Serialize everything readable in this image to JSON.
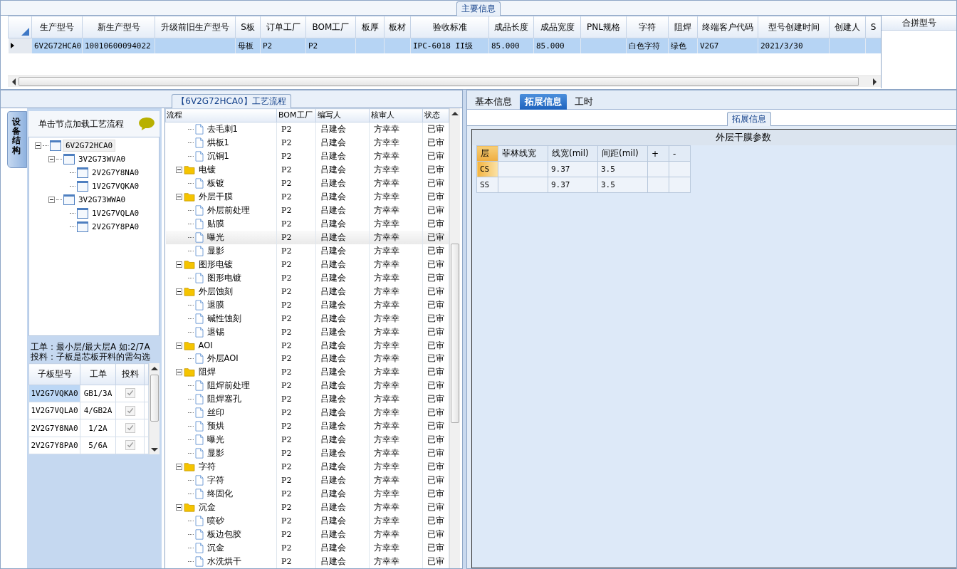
{
  "main_info": {
    "legend": "主要信息",
    "columns": [
      "生产型号",
      "新生产型号",
      "升级前旧生产型号",
      "S板",
      "订单工厂",
      "BOM工厂",
      "板厚",
      "板材",
      "验收标准",
      "成品长度",
      "成品宽度",
      "PNL规格",
      "字符",
      "阻焊",
      "终端客户代码",
      "型号创建时间",
      "创建人",
      "S"
    ],
    "rows": [
      {
        "selected": true,
        "cells": [
          "6V2G72HCA0",
          "10010600094022",
          "",
          "母板",
          "P2",
          "P2",
          "",
          "",
          "IPC-6018 II级",
          "85.000",
          "85.000",
          "",
          "白色字符",
          "绿色",
          "V2G7",
          "2021/3/30",
          "",
          ""
        ]
      }
    ],
    "merge_panel": {
      "header": "合拼型号"
    }
  },
  "process": {
    "legend": "【6V2G72HCA0】工艺流程",
    "side_tab": "设备结构",
    "hint_header": "单击节点加载工艺流程",
    "tree": [
      {
        "label": "6V2G72HCA0",
        "selected": true,
        "expanded": true,
        "children": [
          {
            "label": "3V2G73WVA0",
            "selected": false,
            "expanded": true,
            "children": [
              {
                "label": "2V2G7Y8NA0",
                "selected": false
              },
              {
                "label": "1V2G7VQKA0",
                "selected": false
              }
            ]
          },
          {
            "label": "3V2G73WWA0",
            "selected": false,
            "expanded": true,
            "children": [
              {
                "label": "1V2G7VQLA0",
                "selected": false
              },
              {
                "label": "2V2G7Y8PA0",
                "selected": false
              }
            ]
          }
        ]
      }
    ],
    "notes": [
      "工单：最小层/最大层A 如:2/7A",
      "投料：子板是芯板开料的需勾选"
    ],
    "sub_columns": [
      "子板型号",
      "工单",
      "投料"
    ],
    "sub_rows": [
      {
        "model": "1V2G7VQKA0",
        "order": "GB1/3A",
        "checked": true,
        "selected": true
      },
      {
        "model": "1V2G7VQLA0",
        "order": "4/GB2A",
        "checked": true,
        "selected": false
      },
      {
        "model": "2V2G7Y8NA0",
        "order": "1/2A",
        "checked": true,
        "selected": false
      },
      {
        "model": "2V2G7Y8PA0",
        "order": "5/6A",
        "checked": true,
        "selected": false
      }
    ],
    "flow_columns": [
      "流程",
      "BOM工厂",
      "编写人",
      "核审人",
      "状态"
    ],
    "flow": [
      {
        "kind": "cut",
        "children": [
          {
            "kind": "step",
            "name": "去毛刺1",
            "bom": "P2",
            "author": "吕建会",
            "reviewer": "方幸幸",
            "status": "已审",
            "selected": false
          },
          {
            "kind": "step",
            "name": "烘板1",
            "bom": "P2",
            "author": "吕建会",
            "reviewer": "方幸幸",
            "status": "已审",
            "selected": false
          },
          {
            "kind": "step",
            "name": "沉铜1",
            "bom": "P2",
            "author": "吕建会",
            "reviewer": "方幸幸",
            "status": "已审",
            "selected": false
          }
        ]
      },
      {
        "kind": "group",
        "name": "电镀",
        "bom": "P2",
        "author": "吕建会",
        "reviewer": "方幸幸",
        "status": "已审",
        "expanded": true,
        "children": [
          {
            "kind": "step",
            "name": "板镀",
            "bom": "P2",
            "author": "吕建会",
            "reviewer": "方幸幸",
            "status": "已审",
            "selected": false
          }
        ]
      },
      {
        "kind": "group",
        "name": "外层干膜",
        "bom": "P2",
        "author": "吕建会",
        "reviewer": "方幸幸",
        "status": "已审",
        "expanded": true,
        "children": [
          {
            "kind": "step",
            "name": "外层前处理",
            "bom": "P2",
            "author": "吕建会",
            "reviewer": "方幸幸",
            "status": "已审",
            "selected": false
          },
          {
            "kind": "step",
            "name": "贴膜",
            "bom": "P2",
            "author": "吕建会",
            "reviewer": "方幸幸",
            "status": "已审",
            "selected": false
          },
          {
            "kind": "step",
            "name": "曝光",
            "bom": "P2",
            "author": "吕建会",
            "reviewer": "方幸幸",
            "status": "已审",
            "selected": true
          },
          {
            "kind": "step",
            "name": "显影",
            "bom": "P2",
            "author": "吕建会",
            "reviewer": "方幸幸",
            "status": "已审",
            "selected": false
          }
        ]
      },
      {
        "kind": "group",
        "name": "图形电镀",
        "bom": "P2",
        "author": "吕建会",
        "reviewer": "方幸幸",
        "status": "已审",
        "expanded": true,
        "children": [
          {
            "kind": "step",
            "name": "图形电镀",
            "bom": "P2",
            "author": "吕建会",
            "reviewer": "方幸幸",
            "status": "已审",
            "selected": false
          }
        ]
      },
      {
        "kind": "group",
        "name": "外层蚀刻",
        "bom": "P2",
        "author": "吕建会",
        "reviewer": "方幸幸",
        "status": "已审",
        "expanded": true,
        "children": [
          {
            "kind": "step",
            "name": "退膜",
            "bom": "P2",
            "author": "吕建会",
            "reviewer": "方幸幸",
            "status": "已审",
            "selected": false
          },
          {
            "kind": "step",
            "name": "碱性蚀刻",
            "bom": "P2",
            "author": "吕建会",
            "reviewer": "方幸幸",
            "status": "已审",
            "selected": false
          },
          {
            "kind": "step",
            "name": "退锡",
            "bom": "P2",
            "author": "吕建会",
            "reviewer": "方幸幸",
            "status": "已审",
            "selected": false
          }
        ]
      },
      {
        "kind": "group",
        "name": "AOI",
        "bom": "P2",
        "author": "吕建会",
        "reviewer": "方幸幸",
        "status": "已审",
        "expanded": true,
        "children": [
          {
            "kind": "step",
            "name": "外层AOI",
            "bom": "P2",
            "author": "吕建会",
            "reviewer": "方幸幸",
            "status": "已审",
            "selected": false
          }
        ]
      },
      {
        "kind": "group",
        "name": "阻焊",
        "bom": "P2",
        "author": "吕建会",
        "reviewer": "方幸幸",
        "status": "已审",
        "expanded": true,
        "children": [
          {
            "kind": "step",
            "name": "阻焊前处理",
            "bom": "P2",
            "author": "吕建会",
            "reviewer": "方幸幸",
            "status": "已审",
            "selected": false
          },
          {
            "kind": "step",
            "name": "阻焊塞孔",
            "bom": "P2",
            "author": "吕建会",
            "reviewer": "方幸幸",
            "status": "已审",
            "selected": false
          },
          {
            "kind": "step",
            "name": "丝印",
            "bom": "P2",
            "author": "吕建会",
            "reviewer": "方幸幸",
            "status": "已审",
            "selected": false
          },
          {
            "kind": "step",
            "name": "预烘",
            "bom": "P2",
            "author": "吕建会",
            "reviewer": "方幸幸",
            "status": "已审",
            "selected": false
          },
          {
            "kind": "step",
            "name": "曝光",
            "bom": "P2",
            "author": "吕建会",
            "reviewer": "方幸幸",
            "status": "已审",
            "selected": false
          },
          {
            "kind": "step",
            "name": "显影",
            "bom": "P2",
            "author": "吕建会",
            "reviewer": "方幸幸",
            "status": "已审",
            "selected": false
          }
        ]
      },
      {
        "kind": "group",
        "name": "字符",
        "bom": "P2",
        "author": "吕建会",
        "reviewer": "方幸幸",
        "status": "已审",
        "expanded": true,
        "children": [
          {
            "kind": "step",
            "name": "字符",
            "bom": "P2",
            "author": "吕建会",
            "reviewer": "方幸幸",
            "status": "已审",
            "selected": false
          },
          {
            "kind": "step",
            "name": "终固化",
            "bom": "P2",
            "author": "吕建会",
            "reviewer": "方幸幸",
            "status": "已审",
            "selected": false
          }
        ]
      },
      {
        "kind": "group",
        "name": "沉金",
        "bom": "P2",
        "author": "吕建会",
        "reviewer": "方幸幸",
        "status": "已审",
        "expanded": true,
        "children": [
          {
            "kind": "step",
            "name": "喷砂",
            "bom": "P2",
            "author": "吕建会",
            "reviewer": "方幸幸",
            "status": "已审",
            "selected": false
          },
          {
            "kind": "step",
            "name": "板边包胶",
            "bom": "P2",
            "author": "吕建会",
            "reviewer": "方幸幸",
            "status": "已审",
            "selected": false
          },
          {
            "kind": "step",
            "name": "沉金",
            "bom": "P2",
            "author": "吕建会",
            "reviewer": "方幸幸",
            "status": "已审",
            "selected": false
          },
          {
            "kind": "step",
            "name": "水洗烘干",
            "bom": "P2",
            "author": "吕建会",
            "reviewer": "方幸幸",
            "status": "已审",
            "selected": false
          }
        ]
      }
    ]
  },
  "details": {
    "tabs": [
      {
        "label": "基本信息",
        "selected": false
      },
      {
        "label": "拓展信息",
        "selected": true
      },
      {
        "label": "工时",
        "selected": false
      }
    ],
    "legend": "拓展信息",
    "table_title": "外层干膜参数",
    "columns": [
      "层",
      "菲林线宽",
      "线宽(mil)",
      "间距(mil)",
      "+",
      "-"
    ],
    "rows": [
      {
        "selected": true,
        "cells": [
          "CS",
          "",
          "9.37",
          "3.5",
          "",
          ""
        ]
      },
      {
        "selected": false,
        "cells": [
          "SS",
          "",
          "9.37",
          "3.5",
          "",
          ""
        ]
      }
    ]
  }
}
